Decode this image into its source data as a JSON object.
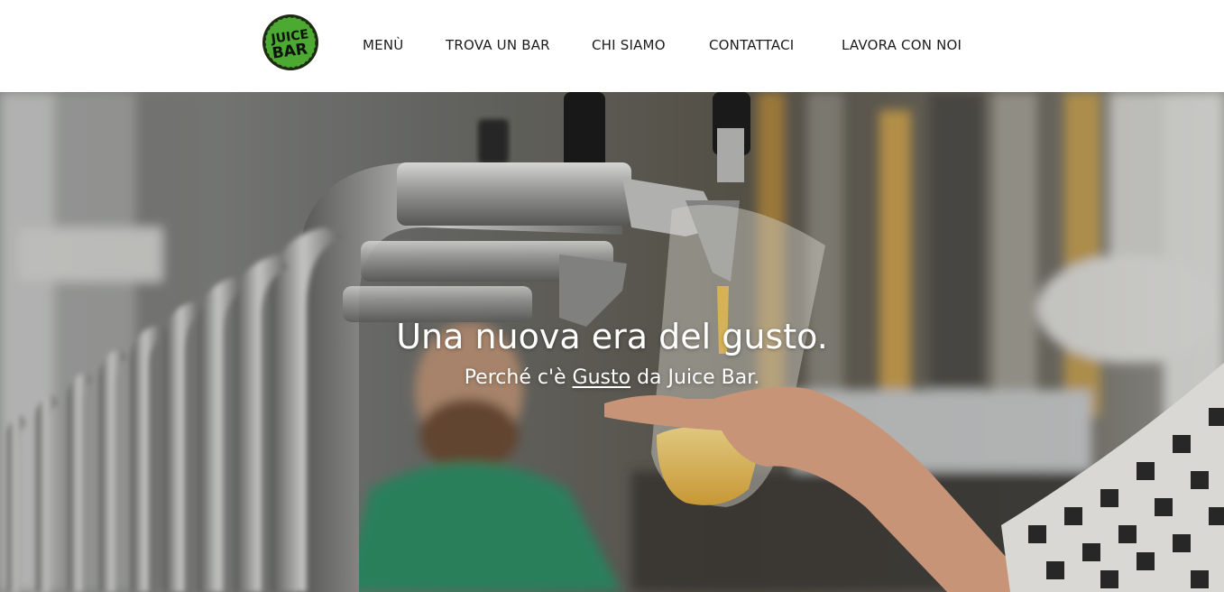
{
  "brand": {
    "logo_text_top": "JUICE",
    "logo_text_bottom": "BAR",
    "logo_color": "#4caa32"
  },
  "nav": {
    "items": [
      {
        "label": "MENÙ"
      },
      {
        "label": "TROVA UN BAR"
      },
      {
        "label": "CHI SIAMO"
      },
      {
        "label": "CONTATTACI"
      },
      {
        "label": "LAVORA CON NOI"
      }
    ]
  },
  "hero": {
    "title": "Una nuova era del gusto.",
    "subtitle_before": "Perché c'è ",
    "subtitle_link": "Gusto",
    "subtitle_after": " da Juice Bar."
  }
}
